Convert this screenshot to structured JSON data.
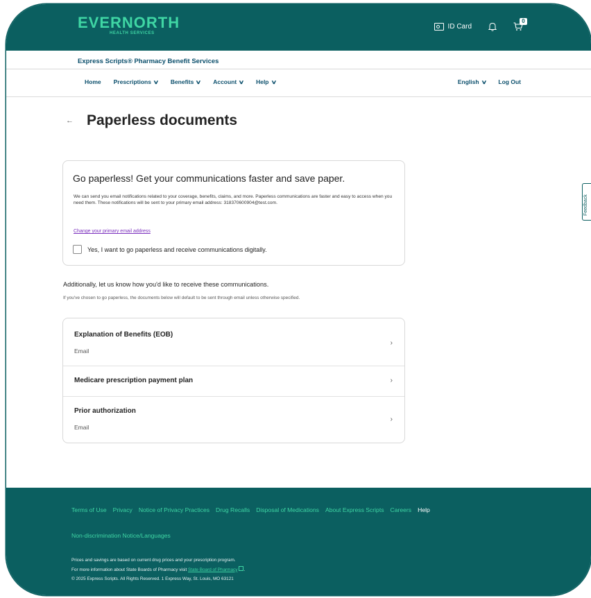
{
  "header": {
    "logo_text": "EVERNORTH",
    "logo_sub": "HEALTH SERVICES",
    "id_card_label": "ID Card",
    "cart_count": "0",
    "icons": {
      "id_card": "id-card-icon",
      "bell": "bell-icon",
      "cart": "cart-icon"
    }
  },
  "brand_bar": {
    "text": "Express Scripts® Pharmacy Benefit Services"
  },
  "nav": {
    "left": [
      {
        "label": "Home",
        "chevron": false
      },
      {
        "label": "Prescriptions",
        "chevron": true
      },
      {
        "label": "Benefits",
        "chevron": true
      },
      {
        "label": "Account",
        "chevron": true
      },
      {
        "label": "Help",
        "chevron": true
      }
    ],
    "right": [
      {
        "label": "English",
        "chevron": true
      },
      {
        "label": "Log Out",
        "chevron": false
      }
    ]
  },
  "page": {
    "back_icon": "back-arrow-icon",
    "title": "Paperless documents"
  },
  "paperless_card": {
    "title": "Go paperless! Get your communications faster and save paper.",
    "body": "We can send you email notifications related to your coverage, benefits, claims, and more. Paperless communications are faster and easy to access when you need them. These notifications will be sent to your primary email address: 318370600904@test.com.",
    "link": "Change your primary email address",
    "checkbox_label": "Yes, I want to go paperless and receive communications digitally.",
    "checked": false
  },
  "additional": {
    "heading": "Additionally, let us know how you'd like to receive these communications.",
    "subtext": "If you've chosen to go paperless, the documents below will default to be sent through email unless otherwise specified."
  },
  "documents": [
    {
      "title": "Explanation of Benefits (EOB)",
      "method": "Email"
    },
    {
      "title": "Medicare prescription payment plan",
      "method": ""
    },
    {
      "title": "Prior authorization",
      "method": "Email"
    }
  ],
  "feedback_tab": "Feedback",
  "footer": {
    "links": [
      {
        "label": "Terms of Use",
        "white": false
      },
      {
        "label": "Privacy",
        "white": false
      },
      {
        "label": "Notice of Privacy Practices",
        "white": false
      },
      {
        "label": "Drug Recalls",
        "white": false
      },
      {
        "label": "Disposal of Medications",
        "white": false
      },
      {
        "label": "About Express Scripts",
        "white": false
      },
      {
        "label": "Careers",
        "white": false
      },
      {
        "label": "Help",
        "white": true
      }
    ],
    "nondiscrimination": "Non-discrimination Notice/Languages",
    "line1": "Prices and savings are based on current drug prices and your prescription program.",
    "line2_prefix": "For more information about State Boards of Pharmacy visit ",
    "line2_link": "State Board of Pharmacy",
    "line3": "© 2025 Express Scripts. All Rights Reserved. 1 Express Way, St. Louis, MO 63121"
  },
  "colors": {
    "brand_teal": "#0b5f60",
    "accent_green": "#3fd6a4",
    "link_purple": "#7a2dbd",
    "nav_text": "#0b4f6c"
  }
}
